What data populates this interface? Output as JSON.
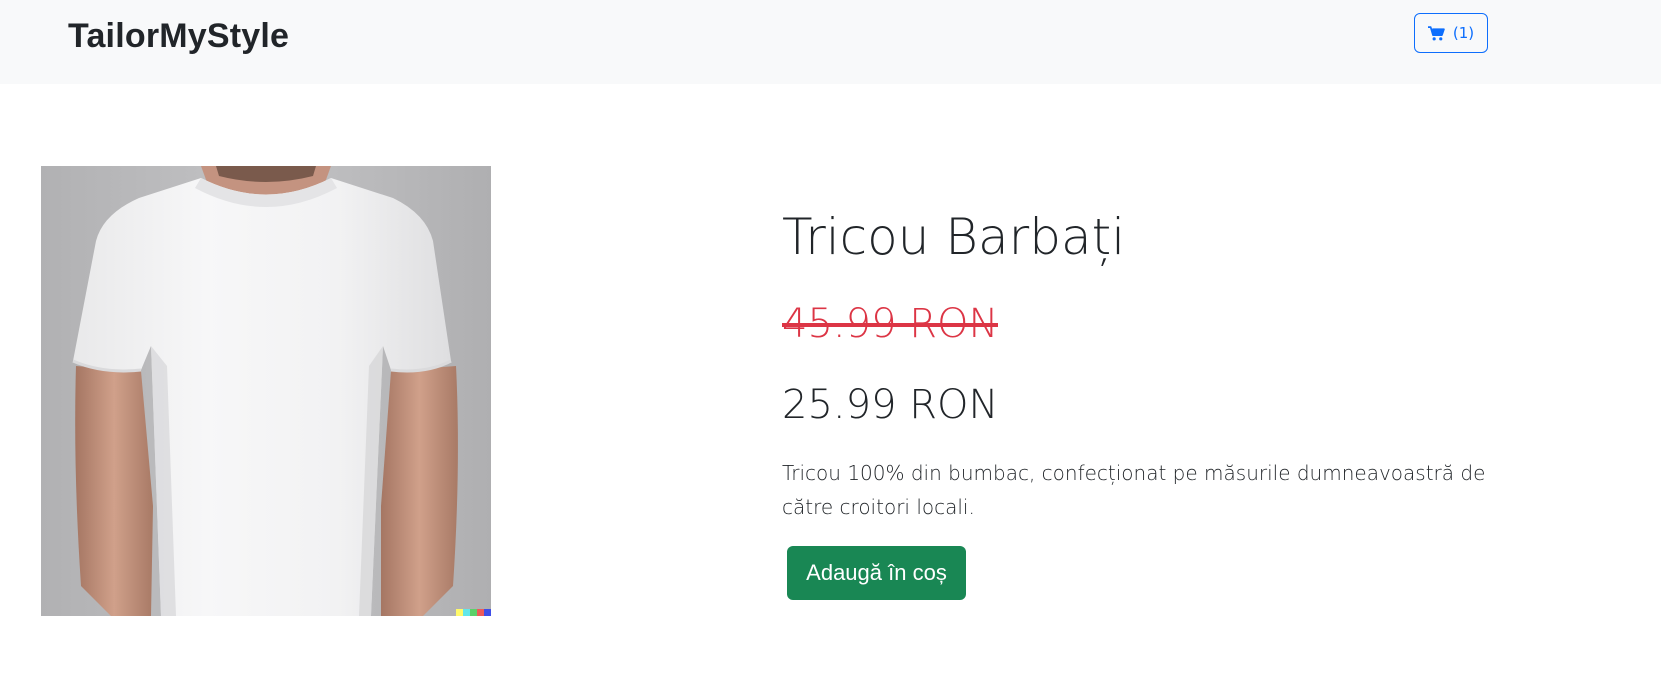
{
  "navbar": {
    "brand": "TailorMyStyle",
    "cart": {
      "icon": "cart-icon",
      "count_label": "(1)",
      "color": "#0d6efd"
    },
    "background": "#f8f9fa"
  },
  "product": {
    "image": "white-tshirt-photo",
    "title": "Tricou Barbați",
    "old_price": "45.99 RON",
    "new_price": "25.99 RON",
    "description": "Tricou 100% din bumbac, confecționat pe măsurile dumneavoastră de către croitori locali.",
    "add_to_cart_label": "Adaugă în coș",
    "colors": {
      "old_price": "#dc3545",
      "add_button": "#198754"
    }
  }
}
